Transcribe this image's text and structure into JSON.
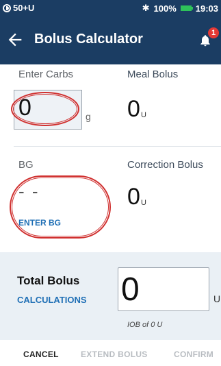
{
  "status_bar": {
    "left_text": "50+U",
    "battery_percent": "100%",
    "time": "19:03",
    "icons": [
      "circle-half-icon",
      "bluetooth-icon",
      "battery-icon"
    ],
    "battery_color": "#2ec25a"
  },
  "app_bar": {
    "title": "Bolus Calculator",
    "back_icon": "arrow-left-icon",
    "notification_icon": "bell-icon",
    "notification_count": "1",
    "background": "#1b3d63"
  },
  "carbs": {
    "label": "Enter Carbs",
    "value": "0",
    "unit": "g"
  },
  "meal_bolus": {
    "label": "Meal Bolus",
    "value": "0",
    "unit": "U"
  },
  "bg": {
    "label": "BG",
    "value": "- -",
    "enter_label": "ENTER BG"
  },
  "correction_bolus": {
    "label": "Correction Bolus",
    "value": "0",
    "unit": "U"
  },
  "total": {
    "label": "Total Bolus",
    "calculations_label": "CALCULATIONS",
    "value": "0",
    "unit": "U",
    "iob": "IOB of 0 U"
  },
  "actions": {
    "cancel": "CANCEL",
    "extend": "EXTEND BOLUS",
    "confirm": "CONFIRM"
  },
  "colors": {
    "accent_link": "#1f6fb5",
    "annotation_red": "#d0302f",
    "disabled_text": "#b8bcc1"
  }
}
